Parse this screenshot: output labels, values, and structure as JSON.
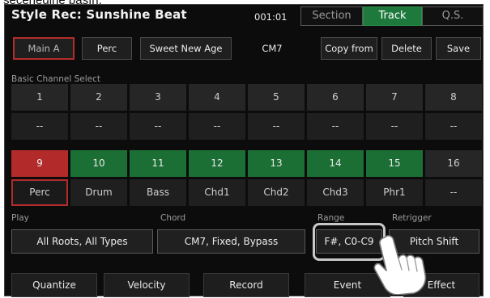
{
  "caption": "seçeneğine basın.",
  "header": {
    "title": "Style Rec: Sunshine Beat",
    "counter": "001:01",
    "tabs": [
      {
        "label": "Section",
        "active": false
      },
      {
        "label": "Track",
        "active": true
      },
      {
        "label": "Q.S.",
        "active": false
      }
    ]
  },
  "toolbar": {
    "main_a": "Main A",
    "perc": "Perc",
    "voice": "Sweet New Age",
    "chord": "CM7",
    "copy_from": "Copy from",
    "delete": "Delete",
    "save": "Save"
  },
  "channels": {
    "label": "Basic Channel Select",
    "row1": [
      {
        "num": "1",
        "val": "--"
      },
      {
        "num": "2",
        "val": "--"
      },
      {
        "num": "3",
        "val": "--"
      },
      {
        "num": "4",
        "val": "--"
      },
      {
        "num": "5",
        "val": "--"
      },
      {
        "num": "6",
        "val": "--"
      },
      {
        "num": "7",
        "val": "--"
      },
      {
        "num": "8",
        "val": "--"
      }
    ],
    "row2": [
      {
        "num": "9",
        "val": "Perc",
        "state": "selected"
      },
      {
        "num": "10",
        "val": "Drum",
        "state": "assigned"
      },
      {
        "num": "11",
        "val": "Bass",
        "state": "assigned"
      },
      {
        "num": "12",
        "val": "Chd1",
        "state": "assigned"
      },
      {
        "num": "13",
        "val": "Chd2",
        "state": "assigned"
      },
      {
        "num": "14",
        "val": "Chd3",
        "state": "assigned"
      },
      {
        "num": "15",
        "val": "Phr1",
        "state": "assigned"
      },
      {
        "num": "16",
        "val": "--",
        "state": "empty"
      }
    ]
  },
  "options": {
    "play_label": "Play",
    "play_value": "All Roots, All Types",
    "chord_label": "Chord",
    "chord_value": "CM7, Fixed, Bypass",
    "range_label": "Range",
    "range_value": "F#, C0-C9",
    "retrigger_label": "Retrigger",
    "retrigger_value": "Pitch Shift"
  },
  "bottom_bar": [
    "Quantize",
    "Velocity",
    "Record",
    "Event",
    "Effect"
  ],
  "colors": {
    "background": "#0c0c0c",
    "accent_green": "#1b6f35",
    "accent_red": "#b32a2a",
    "highlight": "#c8c8c8"
  },
  "icons": {
    "pointer": "pointing-hand-icon"
  }
}
